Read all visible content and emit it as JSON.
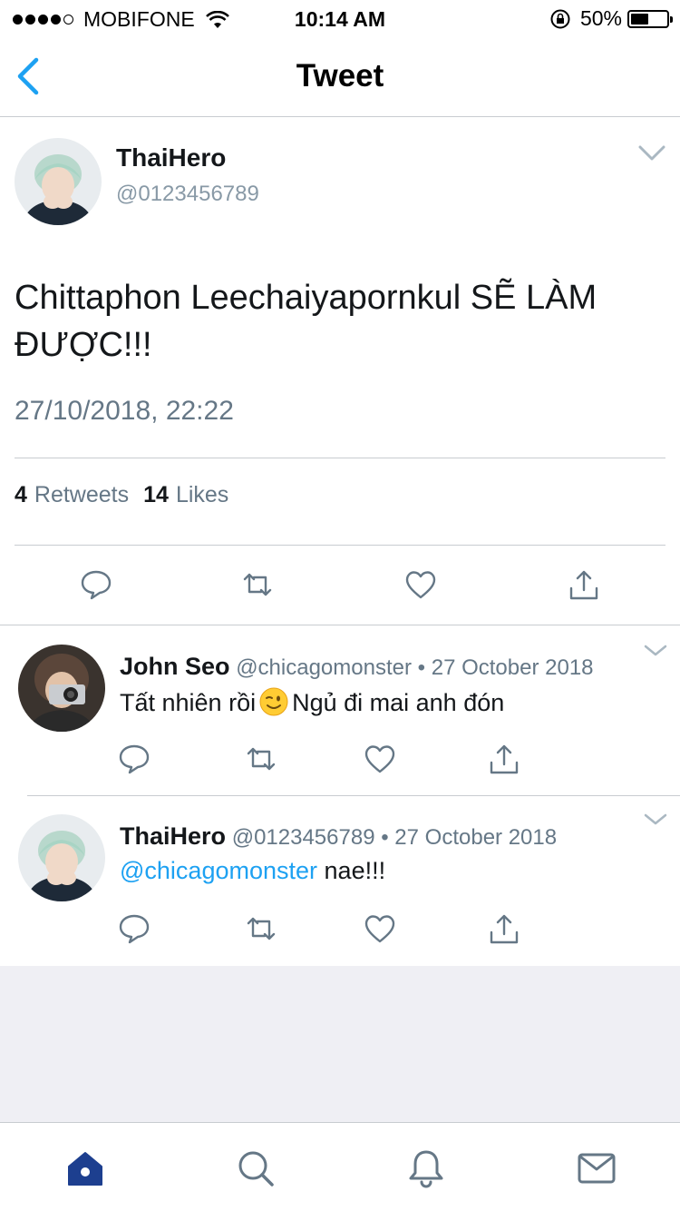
{
  "status_bar": {
    "carrier": "MOBIFONE",
    "time": "10:14 AM",
    "battery": "50%",
    "battery_level": 0.5
  },
  "nav": {
    "title": "Tweet",
    "back_icon": "chevron-left-icon"
  },
  "tweet": {
    "name": "ThaiHero",
    "handle": "@0123456789",
    "text": "Chittaphon Leechaiyapornkul SẼ LÀM ĐƯỢC!!!",
    "timestamp": "27/10/2018, 22:22",
    "retweets_count": "4",
    "retweets_label": "Retweets",
    "likes_count": "14",
    "likes_label": "Likes"
  },
  "replies": [
    {
      "name": "John Seo",
      "handle": "@chicagomonster",
      "separator": "•",
      "date": "27 October 2018",
      "text_before": "Tất nhiên rồi",
      "emoji": "winking-face",
      "text_after": "Ngủ đi mai anh đón"
    },
    {
      "name": "ThaiHero",
      "handle": "@0123456789",
      "separator": "•",
      "date": "27 October 2018",
      "mention": "@chicagomonster",
      "text_after": "nae!!!"
    }
  ],
  "tab_bar": {
    "items": [
      "home-icon",
      "search-icon",
      "notifications-icon",
      "messages-icon"
    ]
  },
  "colors": {
    "accent": "#1da1f2",
    "text_secondary": "#657786",
    "separator": "#c8ccd0",
    "background_gray": "#efeff4"
  }
}
